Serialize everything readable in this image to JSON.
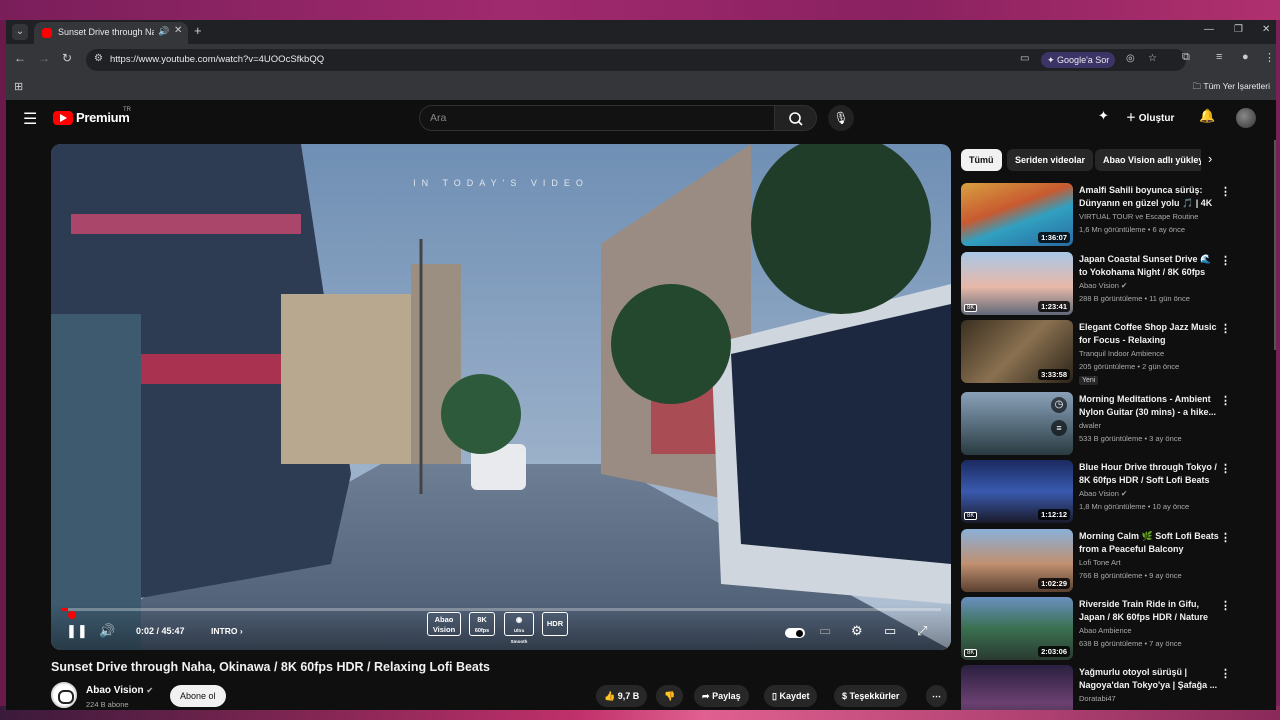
{
  "browser": {
    "tab_title": "Sunset Drive through Naha, Okinawa / 8K 60fps HDR / Relaxing Lofi Beats",
    "url": "https://www.youtube.com/watch?v=4UOOcSfkbQQ",
    "google_ask": "Google'a Sor",
    "all_bookmarks": "Tüm Yer İşaretleri"
  },
  "youtube": {
    "logo_text": "Premium",
    "logo_region": "TR",
    "search_placeholder": "Ara",
    "create_label": "Oluştur"
  },
  "player": {
    "overlay_text": "IN TODAY'S VIDEO",
    "current_time": "0:02 / 45:47",
    "chapter": "INTRO",
    "progress_fraction": 0.0007,
    "badges": [
      {
        "top": "Abao",
        "bottom": "Vision"
      },
      {
        "top": "8K",
        "bottom": "60fps"
      },
      {
        "top": "◉",
        "bottom": "Ultra Smooth"
      },
      {
        "top": "HDR",
        "bottom": ""
      }
    ]
  },
  "video": {
    "title": "Sunset Drive through Naha, Okinawa / 8K 60fps HDR / Relaxing Lofi Beats",
    "channel": "Abao Vision",
    "subscribers": "224 B abone",
    "subscribe_label": "Abone ol",
    "likes": "9,7 B",
    "share_label": "Paylaş",
    "save_label": "Kaydet",
    "thanks_label": "Teşekkürler"
  },
  "chips": [
    "Tümü",
    "Seriden videolar",
    "Abao Vision adlı yükleyicinin videoları"
  ],
  "recommendations": [
    {
      "title": "Amalfi Sahili boyunca sürüş: Dünyanın en güzel yolu 🎵 | 4K",
      "channel": "VIRTUAL TOUR ve Escape Routine",
      "meta": "1,6 Mn görüntüleme • 6 ay önce",
      "duration": "1:36:07",
      "eightk": "",
      "new": ""
    },
    {
      "title": "Japan Coastal Sunset Drive 🌊 to Yokohama Night / 8K 60fps HDR",
      "channel": "Abao Vision ✔",
      "meta": "288 B görüntüleme • 11 gün önce",
      "duration": "1:23:41",
      "eightk": "8K",
      "new": ""
    },
    {
      "title": "Elegant Coffee Shop Jazz Music for Focus - Relaxing Background",
      "channel": "Tranquil Indoor Ambience",
      "meta": "205 görüntüleme • 2 gün önce",
      "duration": "3:33:58",
      "eightk": "",
      "new": "Yeni"
    },
    {
      "title": "Morning Meditations - Ambient Nylon Guitar (30 mins) - a hike...",
      "channel": "dwaler",
      "meta": "533 B görüntüleme • 3 ay önce",
      "duration": "",
      "eightk": "",
      "new": ""
    },
    {
      "title": "Blue Hour Drive through Tokyo / 8K 60fps HDR / Soft Lofi Beats",
      "channel": "Abao Vision ✔",
      "meta": "1,8 Mn görüntüleme • 10 ay önce",
      "duration": "1:12:12",
      "eightk": "8K",
      "new": ""
    },
    {
      "title": "Morning Calm 🌿 Soft Lofi Beats from a Peaceful Balcony",
      "channel": "Lofi Tone Art",
      "meta": "766 B görüntüleme • 9 ay önce",
      "duration": "1:02:29",
      "eightk": "",
      "new": ""
    },
    {
      "title": "Riverside Train Ride in Gifu, Japan / 8K 60fps HDR / Nature",
      "channel": "Abao Ambience",
      "meta": "638 B görüntüleme • 7 ay önce",
      "duration": "2:03:06",
      "eightk": "8K",
      "new": ""
    },
    {
      "title": "Yağmurlu otoyol sürüşü | Nagoya'dan Tokyo'ya | Şafağa ...",
      "channel": "Doratabi47",
      "meta": "",
      "duration": "",
      "eightk": "",
      "new": ""
    }
  ],
  "colors": {
    "brand": "#ff0000",
    "background": "#0f0f0f",
    "chip_active": "#f1f1f1"
  }
}
